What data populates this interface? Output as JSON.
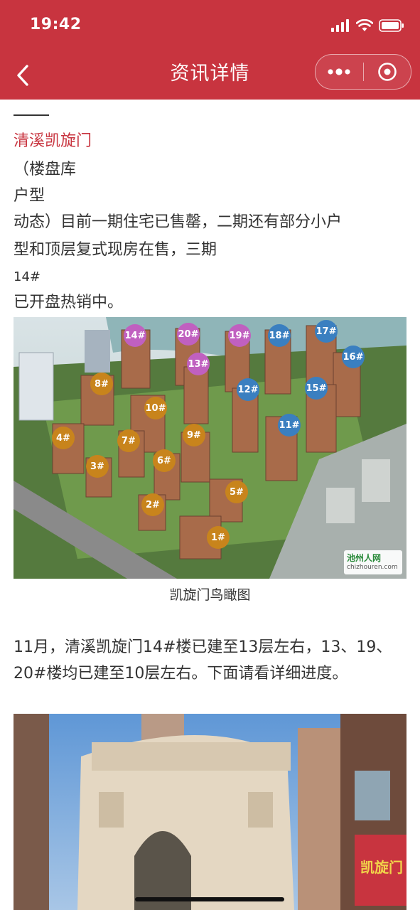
{
  "status_bar": {
    "time": "19:42"
  },
  "nav": {
    "title": "资讯详情",
    "back_icon": "chevron-left-icon",
    "more_icon": "more-dots-icon",
    "close_icon": "target-circle-icon"
  },
  "article": {
    "title": "清溪凯旋门",
    "lines": [
      "（楼盘库",
      "户型",
      "动态）目前一期住宅已售罄，二期还有部分小户",
      "型和顶层复式现房在售，三期",
      "14#",
      "已开盘热销中。"
    ],
    "image1": {
      "caption": "凯旋门鸟瞰图",
      "watermark_text": "池州人网",
      "watermark_url": "chizhouren.com",
      "building_labels": [
        "14#",
        "20#",
        "19#",
        "18#",
        "17#",
        "16#",
        "13#",
        "8#",
        "12#",
        "15#",
        "10#",
        "11#",
        "4#",
        "7#",
        "9#",
        "6#",
        "3#",
        "5#",
        "2#",
        "1#"
      ]
    },
    "para2": "11月，清溪凯旋门14#楼已建至13层左右，13、19、20#楼均已建至10层左右。下面请看详细进度。",
    "image2": {
      "sign_text": "凯旋门"
    }
  },
  "colors": {
    "brand_red": "#c8343f",
    "pin_purple": "#c060c0",
    "pin_blue": "#3a7fc0",
    "pin_orange": "#c8841c"
  }
}
